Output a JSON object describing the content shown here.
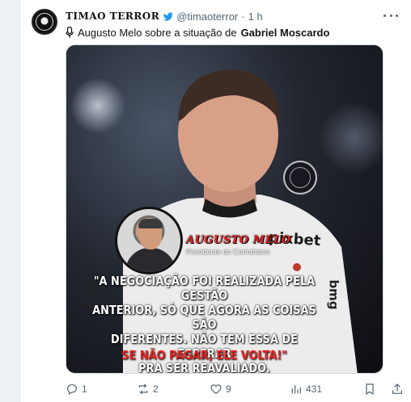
{
  "tweet": {
    "display_name": "TIMAO TERROR",
    "handle": "@timaoterror",
    "separator": "·",
    "time": "1 h",
    "text_prefix": "Augusto Melo sobre a situação de ",
    "text_bold": "Gabriel Moscardo",
    "icons": [
      "verified-icon",
      "mic-icon",
      "more-icon"
    ]
  },
  "media": {
    "sponsor": "pixbet",
    "side_sponsor": "bmg",
    "left_sponsor": "bmg",
    "speaker_name": "AUGUSTO MELO",
    "speaker_role": "Presidente do Corinthians",
    "quote_line1": "\"A NEGOCIAÇÃO FOI REALIZADA PELA GESTÃO",
    "quote_line2": "ANTERIOR, SÓ QUE AGORA AS COISAS SÃO",
    "quote_line3": "DIFERENTES. NÃO TEM ESSA DE ESPERAR",
    "quote_line4": "PRA SER REAVALIADO.",
    "quote_red": "SE NÃO PAGAR, ELE VOLTA!\""
  },
  "actions": {
    "replies": "1",
    "reposts": "2",
    "likes": "9",
    "views": "431",
    "icons": [
      "reply-icon",
      "repost-icon",
      "like-icon",
      "views-icon",
      "bookmark-icon",
      "share-icon"
    ]
  },
  "colors": {
    "accent_blue": "#1d9bf0",
    "muted": "#536471",
    "red_text": "#e82020"
  }
}
